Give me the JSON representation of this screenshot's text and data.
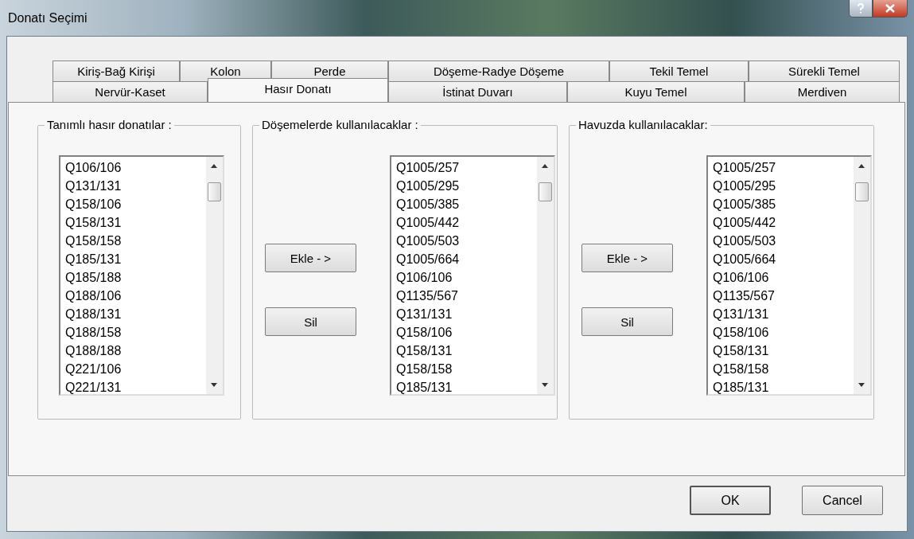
{
  "window": {
    "title": "Donatı Seçimi"
  },
  "tab_rows": [
    [
      {
        "label": "Kiriş-Bağ Kirişi",
        "selected": false
      },
      {
        "label": "Kolon",
        "selected": false
      },
      {
        "label": "Perde",
        "selected": false
      },
      {
        "label": "Döşeme-Radye Döşeme",
        "selected": false
      },
      {
        "label": "Tekil Temel",
        "selected": false
      },
      {
        "label": "Sürekli Temel",
        "selected": false
      }
    ],
    [
      {
        "label": "Nervür-Kaset",
        "selected": false
      },
      {
        "label": "Hasır Donatı",
        "selected": true
      },
      {
        "label": "İstinat Duvarı",
        "selected": false
      },
      {
        "label": "Kuyu Temel",
        "selected": false
      },
      {
        "label": "Merdiven",
        "selected": false
      }
    ]
  ],
  "groups": [
    {
      "title": "Tanımlı hasır donatılar :",
      "items": [
        "Q106/106",
        "Q131/131",
        "Q158/106",
        "Q158/131",
        "Q158/158",
        "Q185/131",
        "Q185/188",
        "Q188/106",
        "Q188/131",
        "Q188/158",
        "Q188/188",
        "Q221/106",
        "Q221/131"
      ]
    },
    {
      "title": "Döşemelerde kullanılacaklar :",
      "buttons": [
        "Ekle - >",
        "Sil"
      ],
      "items": [
        "Q1005/257",
        "Q1005/295",
        "Q1005/385",
        "Q1005/442",
        "Q1005/503",
        "Q1005/664",
        "Q106/106",
        "Q1135/567",
        "Q131/131",
        "Q158/106",
        "Q158/131",
        "Q158/158",
        "Q185/131"
      ]
    },
    {
      "title": "Havuzda kullanılacaklar:",
      "buttons": [
        "Ekle - >",
        "Sil"
      ],
      "items": [
        "Q1005/257",
        "Q1005/295",
        "Q1005/385",
        "Q1005/442",
        "Q1005/503",
        "Q1005/664",
        "Q106/106",
        "Q1135/567",
        "Q131/131",
        "Q158/106",
        "Q158/131",
        "Q158/158",
        "Q185/131"
      ]
    }
  ],
  "buttons": [
    "OK",
    "Cancel"
  ]
}
